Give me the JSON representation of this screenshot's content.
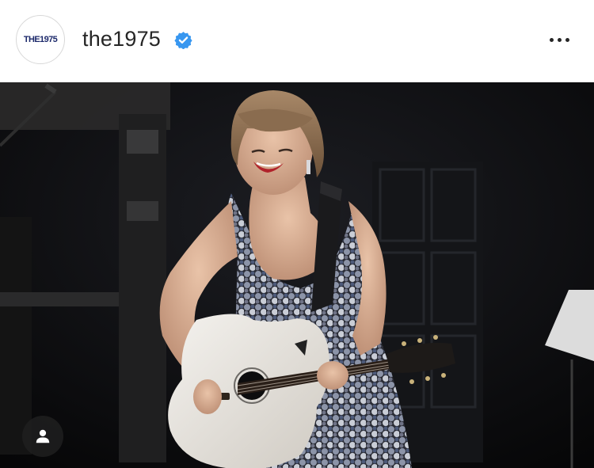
{
  "post": {
    "username": "the1975",
    "verified": true,
    "avatar_text": "THE1975"
  },
  "icons": {
    "verified": "verified-badge-icon",
    "more": "more-options-icon",
    "tagged": "user-tag-icon"
  },
  "colors": {
    "verified_blue": "#3897f0",
    "username": "#262626",
    "logo_navy": "#1d2a6b"
  }
}
